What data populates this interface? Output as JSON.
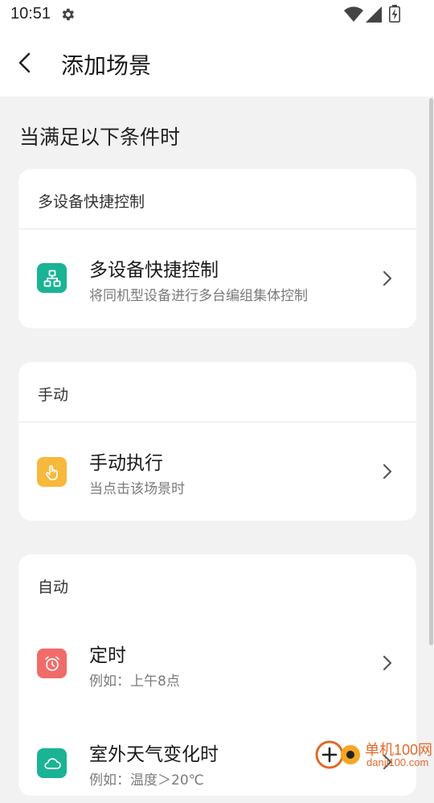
{
  "status_bar": {
    "time": "10:51",
    "icons": [
      "gear-icon",
      "wifi-icon",
      "signal-icon",
      "battery-icon"
    ]
  },
  "app_bar": {
    "title": "添加场景",
    "back_icon": "back-arrow-icon"
  },
  "section_title": "当满足以下条件时",
  "cards": {
    "multi_device": {
      "header": "多设备快捷控制",
      "item": {
        "label": "多设备快捷控制",
        "sub": "将同机型设备进行多台编组集体控制",
        "icon": "device-group-icon",
        "icon_color": "#1ab394"
      }
    },
    "manual": {
      "header": "手动",
      "item": {
        "label": "手动执行",
        "sub": "当点击该场景时",
        "icon": "hand-tap-icon",
        "icon_color": "#f6b93b"
      }
    },
    "auto": {
      "header": "自动",
      "items": [
        {
          "label": "定时",
          "sub": "例如：上午8点",
          "icon": "alarm-clock-icon",
          "icon_color": "#f26b6b"
        },
        {
          "label": "室外天气变化时",
          "sub": "例如：温度＞20℃",
          "icon": "cloud-icon",
          "icon_color": "#1ab394"
        }
      ]
    }
  },
  "watermark": {
    "line1": "单机100网",
    "line2": "danji100.com"
  }
}
